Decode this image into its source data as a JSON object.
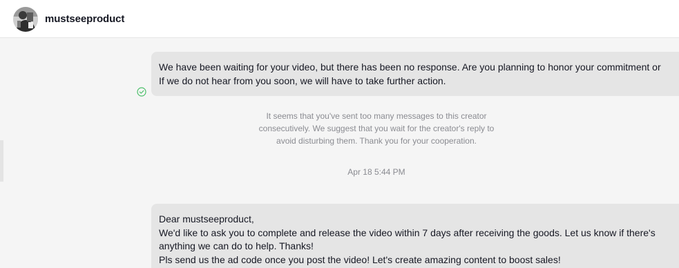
{
  "header": {
    "username": "mustseeproduct",
    "avatar_icon": "profile-photo-avatar"
  },
  "messages": [
    {
      "lines": [
        "We have been waiting for your video, but there has been no response. Are you planning to honor your commitment or",
        "If we do not hear from you soon, we will have to take further action."
      ],
      "status_icon": "read-check-icon"
    },
    {
      "lines": [
        "Dear mustseeproduct,",
        "We'd like to ask you to complete and release the video within 7 days after receiving the goods. Let us know if there's",
        "anything we can do to help. Thanks!",
        "Pls send us the ad code once you post the video! Let's create amazing content to boost sales!"
      ]
    }
  ],
  "system_note": {
    "lines": [
      "It seems that you've sent too many messages to this creator",
      "consecutively. We suggest that you wait for the creator's reply to",
      "avoid disturbing them. Thank you for your cooperation."
    ]
  },
  "timestamp": "Apr 18 5:44 PM",
  "colors": {
    "bubble_bg": "#e5e5e5",
    "page_bg": "#f5f5f5",
    "status_green": "#4cbf6a",
    "muted_text": "#8a8b91"
  }
}
